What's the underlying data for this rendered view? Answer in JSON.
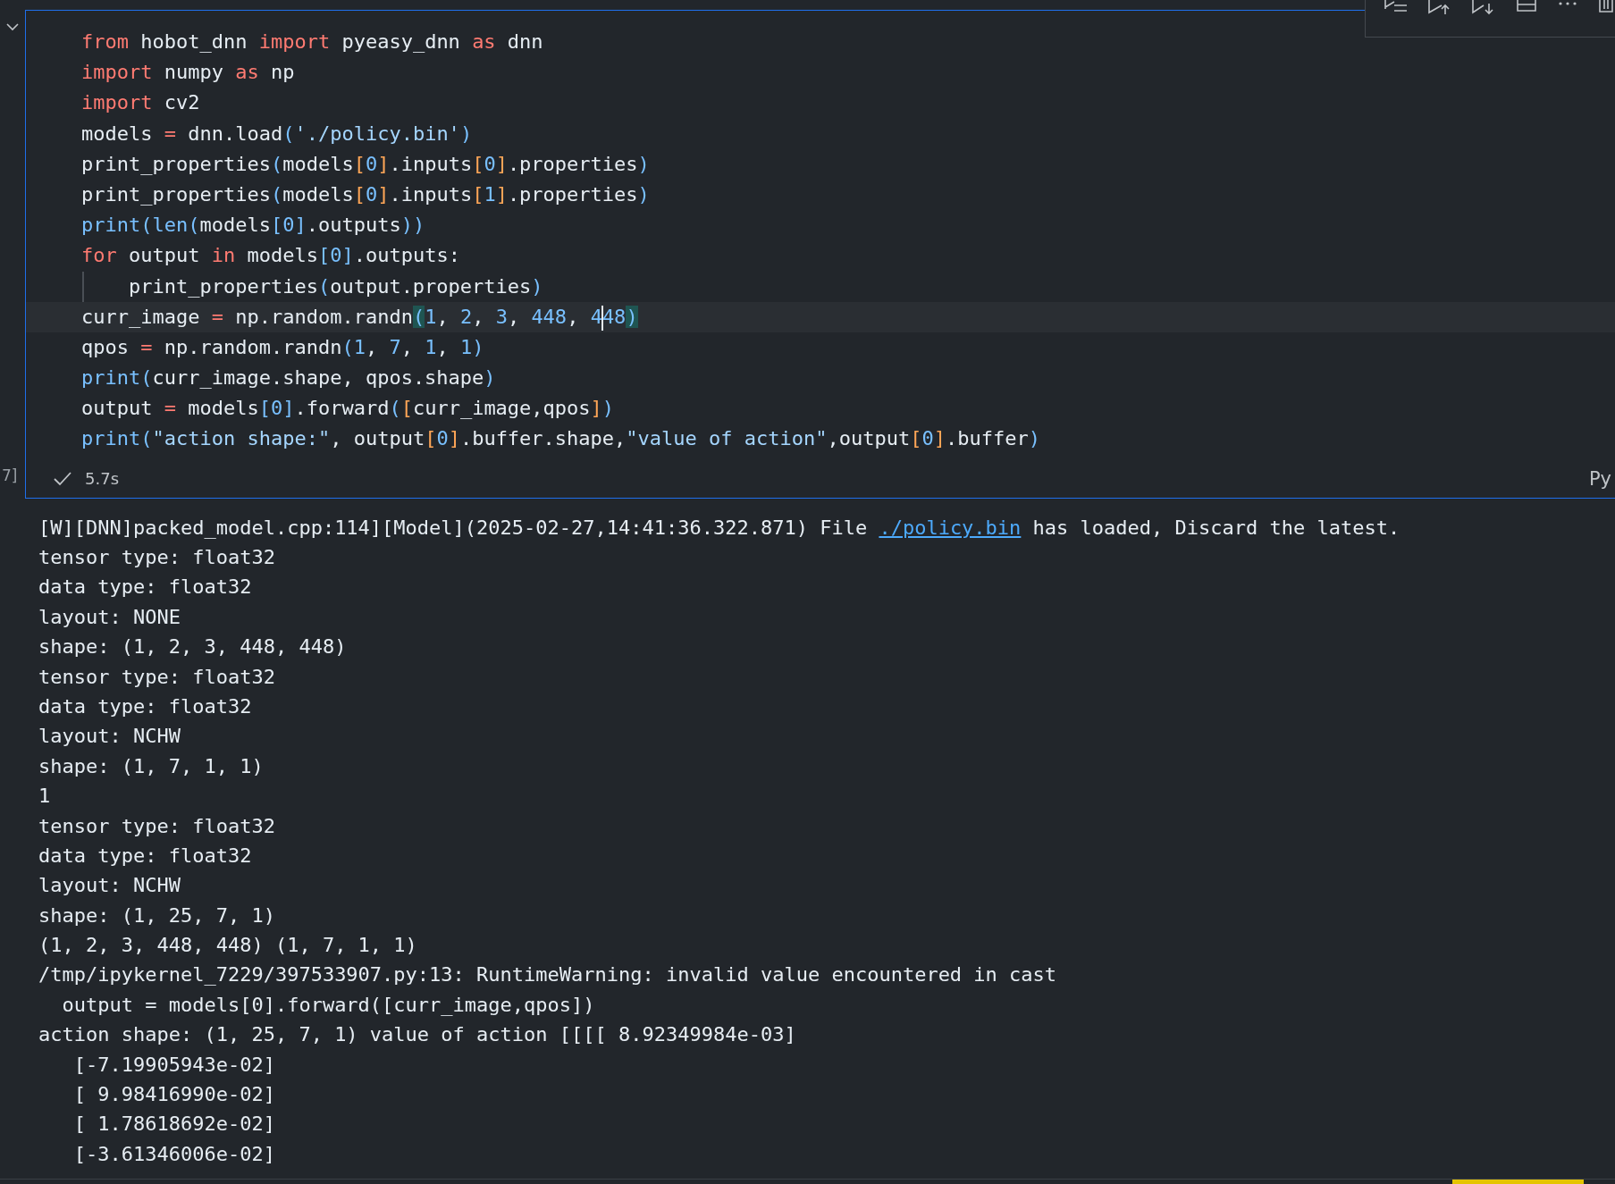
{
  "cell": {
    "collapsed": false,
    "execution_count": "7]",
    "lines": [
      {
        "current": false,
        "indent_guide": false,
        "tokens": [
          {
            "t": "from",
            "kind": "kw"
          },
          {
            "t": " hobot_dnn ",
            "kind": "id"
          },
          {
            "t": "import",
            "kind": "kw"
          },
          {
            "t": " pyeasy_dnn ",
            "kind": "id"
          },
          {
            "t": "as",
            "kind": "kw"
          },
          {
            "t": " dnn",
            "kind": "id"
          }
        ]
      },
      {
        "current": false,
        "indent_guide": false,
        "tokens": [
          {
            "t": "import",
            "kind": "kw"
          },
          {
            "t": " numpy ",
            "kind": "id"
          },
          {
            "t": "as",
            "kind": "kw"
          },
          {
            "t": " np",
            "kind": "id"
          }
        ]
      },
      {
        "current": false,
        "indent_guide": false,
        "tokens": [
          {
            "t": "import",
            "kind": "kw"
          },
          {
            "t": " cv2",
            "kind": "id"
          }
        ]
      },
      {
        "current": false,
        "indent_guide": false,
        "tokens": [
          {
            "t": "models ",
            "kind": "id"
          },
          {
            "t": "=",
            "kind": "kw"
          },
          {
            "t": " dnn.load",
            "kind": "id"
          },
          {
            "t": "(",
            "kind": "b1"
          },
          {
            "t": "'./policy.bin'",
            "kind": "str"
          },
          {
            "t": ")",
            "kind": "b1"
          }
        ]
      },
      {
        "current": false,
        "indent_guide": false,
        "tokens": [
          {
            "t": "print_properties",
            "kind": "id"
          },
          {
            "t": "(",
            "kind": "b1"
          },
          {
            "t": "models",
            "kind": "id"
          },
          {
            "t": "[",
            "kind": "b2"
          },
          {
            "t": "0",
            "kind": "num"
          },
          {
            "t": "]",
            "kind": "b2"
          },
          {
            "t": ".inputs",
            "kind": "id"
          },
          {
            "t": "[",
            "kind": "b2"
          },
          {
            "t": "0",
            "kind": "num"
          },
          {
            "t": "]",
            "kind": "b2"
          },
          {
            "t": ".properties",
            "kind": "id"
          },
          {
            "t": ")",
            "kind": "b1"
          }
        ]
      },
      {
        "current": false,
        "indent_guide": false,
        "tokens": [
          {
            "t": "print_properties",
            "kind": "id"
          },
          {
            "t": "(",
            "kind": "b1"
          },
          {
            "t": "models",
            "kind": "id"
          },
          {
            "t": "[",
            "kind": "b2"
          },
          {
            "t": "0",
            "kind": "num"
          },
          {
            "t": "]",
            "kind": "b2"
          },
          {
            "t": ".inputs",
            "kind": "id"
          },
          {
            "t": "[",
            "kind": "b2"
          },
          {
            "t": "1",
            "kind": "num"
          },
          {
            "t": "]",
            "kind": "b2"
          },
          {
            "t": ".properties",
            "kind": "id"
          },
          {
            "t": ")",
            "kind": "b1"
          }
        ]
      },
      {
        "current": false,
        "indent_guide": false,
        "tokens": [
          {
            "t": "print",
            "kind": "fn"
          },
          {
            "t": "(",
            "kind": "b1"
          },
          {
            "t": "len",
            "kind": "fn"
          },
          {
            "t": "(",
            "kind": "b1"
          },
          {
            "t": "models",
            "kind": "id"
          },
          {
            "t": "[",
            "kind": "b1"
          },
          {
            "t": "0",
            "kind": "num"
          },
          {
            "t": "]",
            "kind": "b1"
          },
          {
            "t": ".outputs",
            "kind": "id"
          },
          {
            "t": "))",
            "kind": "b1"
          }
        ]
      },
      {
        "current": false,
        "indent_guide": false,
        "tokens": [
          {
            "t": "for",
            "kind": "kw"
          },
          {
            "t": " output ",
            "kind": "id"
          },
          {
            "t": "in",
            "kind": "kw"
          },
          {
            "t": " models",
            "kind": "id"
          },
          {
            "t": "[",
            "kind": "b1"
          },
          {
            "t": "0",
            "kind": "num"
          },
          {
            "t": "]",
            "kind": "b1"
          },
          {
            "t": ".outputs:",
            "kind": "id"
          }
        ]
      },
      {
        "current": false,
        "indent_guide": true,
        "tokens": [
          {
            "t": "    print_properties",
            "kind": "id"
          },
          {
            "t": "(",
            "kind": "b1"
          },
          {
            "t": "output.properties",
            "kind": "id"
          },
          {
            "t": ")",
            "kind": "b1"
          }
        ]
      },
      {
        "current": true,
        "indent_guide": false,
        "tokens": [
          {
            "t": "curr_image ",
            "kind": "id"
          },
          {
            "t": "=",
            "kind": "kw"
          },
          {
            "t": " np.random.randn",
            "kind": "id"
          },
          {
            "t": "(",
            "kind": "match"
          },
          {
            "t": "1",
            "kind": "num"
          },
          {
            "t": ", ",
            "kind": "id"
          },
          {
            "t": "2",
            "kind": "num"
          },
          {
            "t": ", ",
            "kind": "id"
          },
          {
            "t": "3",
            "kind": "num"
          },
          {
            "t": ", ",
            "kind": "id"
          },
          {
            "t": "448",
            "kind": "num"
          },
          {
            "t": ", ",
            "kind": "id"
          },
          {
            "t": "4",
            "kind": "num"
          },
          {
            "kind": "cursor"
          },
          {
            "t": "48",
            "kind": "num"
          },
          {
            "t": ")",
            "kind": "match"
          }
        ]
      },
      {
        "current": false,
        "indent_guide": false,
        "tokens": [
          {
            "t": "qpos ",
            "kind": "id"
          },
          {
            "t": "=",
            "kind": "kw"
          },
          {
            "t": " np.random.randn",
            "kind": "id"
          },
          {
            "t": "(",
            "kind": "b1"
          },
          {
            "t": "1",
            "kind": "num"
          },
          {
            "t": ", ",
            "kind": "id"
          },
          {
            "t": "7",
            "kind": "num"
          },
          {
            "t": ", ",
            "kind": "id"
          },
          {
            "t": "1",
            "kind": "num"
          },
          {
            "t": ", ",
            "kind": "id"
          },
          {
            "t": "1",
            "kind": "num"
          },
          {
            "t": ")",
            "kind": "b1"
          }
        ]
      },
      {
        "current": false,
        "indent_guide": false,
        "tokens": [
          {
            "t": "print",
            "kind": "fn"
          },
          {
            "t": "(",
            "kind": "b1"
          },
          {
            "t": "curr_image.shape, qpos.shape",
            "kind": "id"
          },
          {
            "t": ")",
            "kind": "b1"
          }
        ]
      },
      {
        "current": false,
        "indent_guide": false,
        "tokens": [
          {
            "t": "output ",
            "kind": "id"
          },
          {
            "t": "=",
            "kind": "kw"
          },
          {
            "t": " models",
            "kind": "id"
          },
          {
            "t": "[",
            "kind": "b1"
          },
          {
            "t": "0",
            "kind": "num"
          },
          {
            "t": "]",
            "kind": "b1"
          },
          {
            "t": ".forward",
            "kind": "id"
          },
          {
            "t": "(",
            "kind": "b1"
          },
          {
            "t": "[",
            "kind": "b2"
          },
          {
            "t": "curr_image,qpos",
            "kind": "id"
          },
          {
            "t": "]",
            "kind": "b2"
          },
          {
            "t": ")",
            "kind": "b1"
          }
        ]
      },
      {
        "current": false,
        "indent_guide": false,
        "tokens": [
          {
            "t": "print",
            "kind": "fn"
          },
          {
            "t": "(",
            "kind": "b1"
          },
          {
            "t": "\"action shape:\"",
            "kind": "str"
          },
          {
            "t": ", output",
            "kind": "id"
          },
          {
            "t": "[",
            "kind": "b2"
          },
          {
            "t": "0",
            "kind": "num"
          },
          {
            "t": "]",
            "kind": "b2"
          },
          {
            "t": ".buffer.shape,",
            "kind": "id"
          },
          {
            "t": "\"value of action\"",
            "kind": "str"
          },
          {
            "t": ",output",
            "kind": "id"
          },
          {
            "t": "[",
            "kind": "b2"
          },
          {
            "t": "0",
            "kind": "num"
          },
          {
            "t": "]",
            "kind": "b2"
          },
          {
            "t": ".buffer",
            "kind": "id"
          },
          {
            "t": ")",
            "kind": "b1"
          }
        ]
      }
    ],
    "status": {
      "succeeded": true,
      "duration": "5.7s",
      "language": "Py"
    }
  },
  "output": {
    "first_line": {
      "before": "[W][DNN]packed_model.cpp:114][Model](2025-02-27,14:41:36.322.871) File ",
      "link": "./policy.bin",
      "after": " has loaded, Discard the latest."
    },
    "lines": [
      "tensor type: float32",
      "data type: float32",
      "layout: NONE",
      "shape: (1, 2, 3, 448, 448)",
      "tensor type: float32",
      "data type: float32",
      "layout: NCHW",
      "shape: (1, 7, 1, 1)",
      "1",
      "tensor type: float32",
      "data type: float32",
      "layout: NCHW",
      "shape: (1, 25, 7, 1)",
      "(1, 2, 3, 448, 448) (1, 7, 1, 1)",
      "/tmp/ipykernel_7229/397533907.py:13: RuntimeWarning: invalid value encountered in cast",
      "  output = models[0].forward([curr_image,qpos])",
      "action shape: (1, 25, 7, 1) value of action [[[[ 8.92349984e-03]",
      "   [-7.19905943e-02]",
      "   [ 9.98416990e-02]",
      "   [ 1.78618692e-02]",
      "   [-3.61346006e-02]"
    ]
  }
}
